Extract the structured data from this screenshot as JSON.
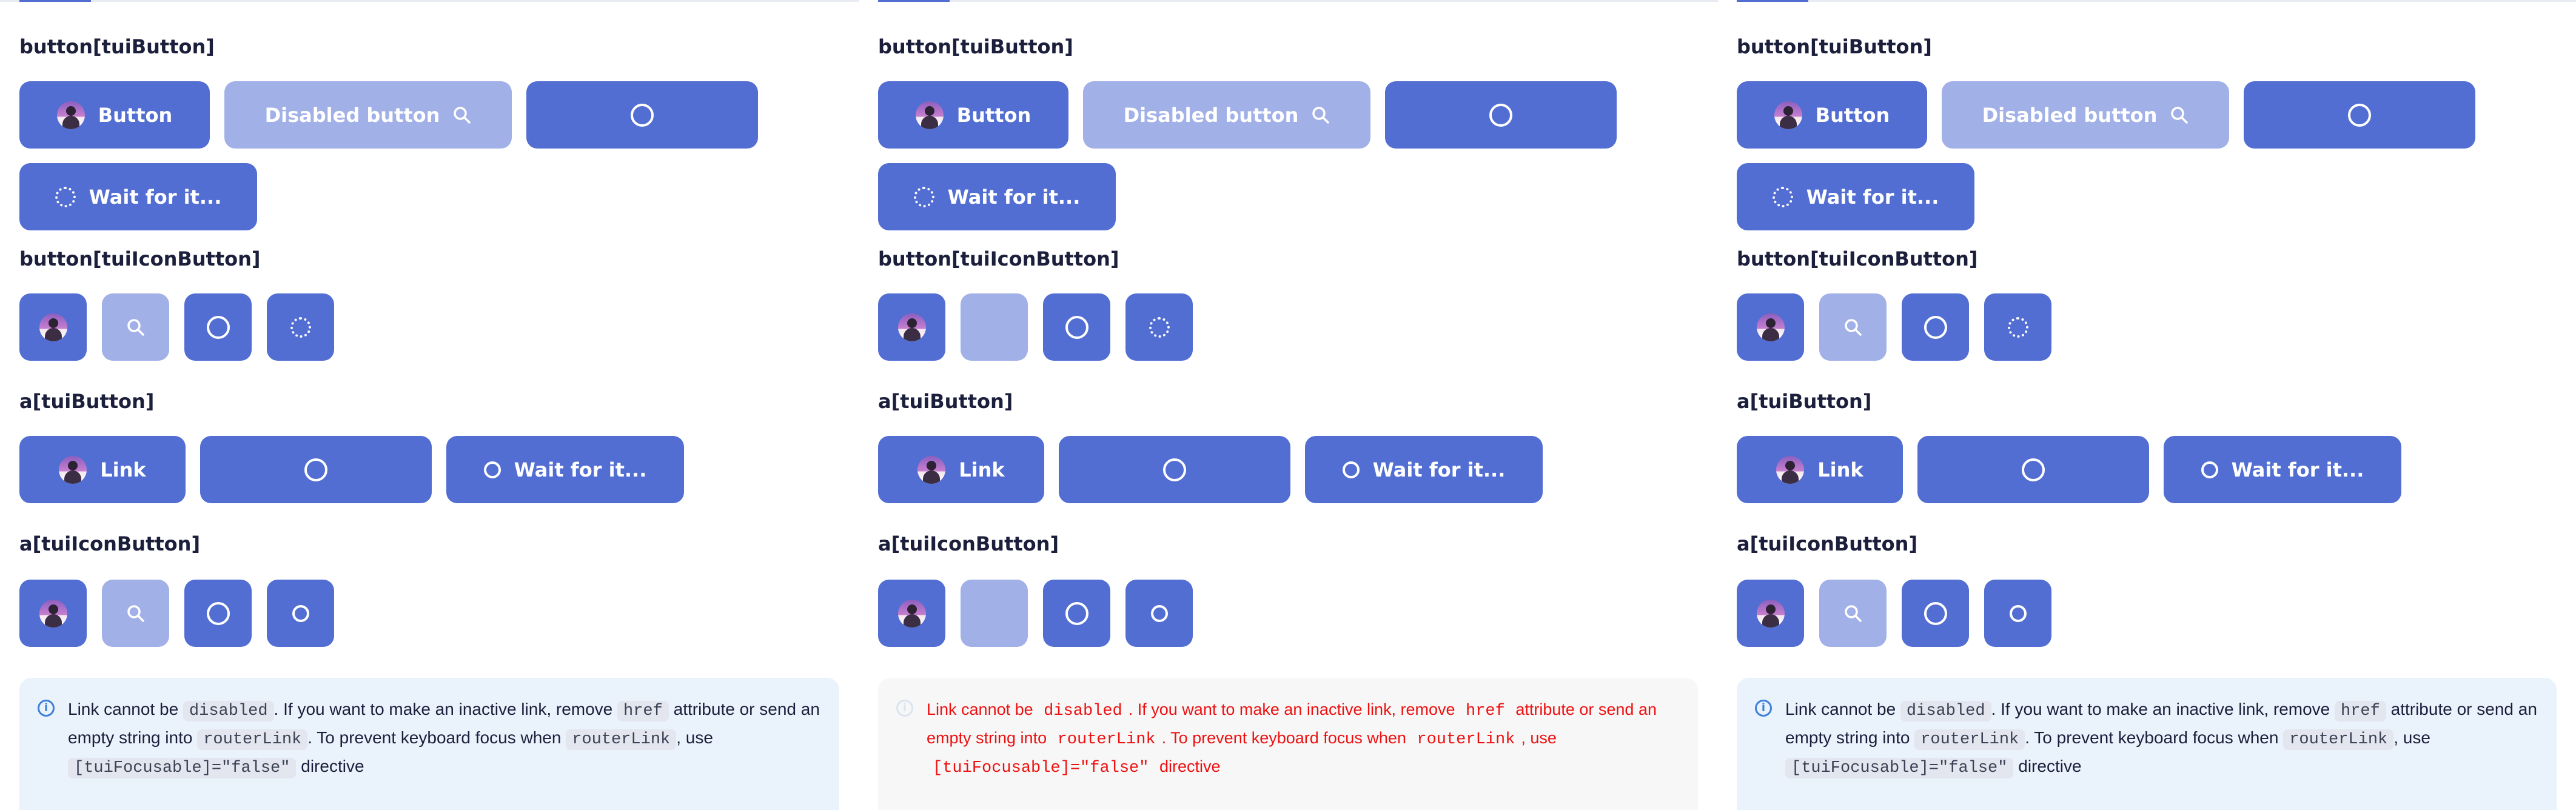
{
  "headings": {
    "button_tui_button": "button[tuiButton]",
    "button_tui_icon_button": "button[tuiIconButton]",
    "a_tui_button": "a[tuiButton]",
    "a_tui_icon_button": "a[tuiIconButton]"
  },
  "buttons": {
    "button_label": "Button",
    "disabled_button_label": "Disabled button",
    "wait_label": "Wait for it...",
    "link_label": "Link"
  },
  "notice": {
    "part1": "Link cannot be ",
    "code_disabled": "disabled",
    "part2": ". If you want to make an inactive link, remove ",
    "code_href": "href",
    "part3": " attribute or send an empty string into ",
    "code_router_link": "routerLink",
    "part4": ". To prevent keyboard focus when ",
    "code_router_link_2": "routerLink",
    "part5": ", use ",
    "code_focusable": "[tuiFocusable]=\"false\"",
    "part6": " directive"
  },
  "icons": {
    "avatar": "avatar-image",
    "search": "search-icon",
    "loader": "loader-icon",
    "circle": "circle-icon",
    "info": "info-icon"
  },
  "colors": {
    "primary": "#526ed3",
    "primary_disabled": "#a1b0e7",
    "notice_bg": "#eaf2fb",
    "info": "#3f7fd6",
    "error_text": "#ee1111"
  }
}
